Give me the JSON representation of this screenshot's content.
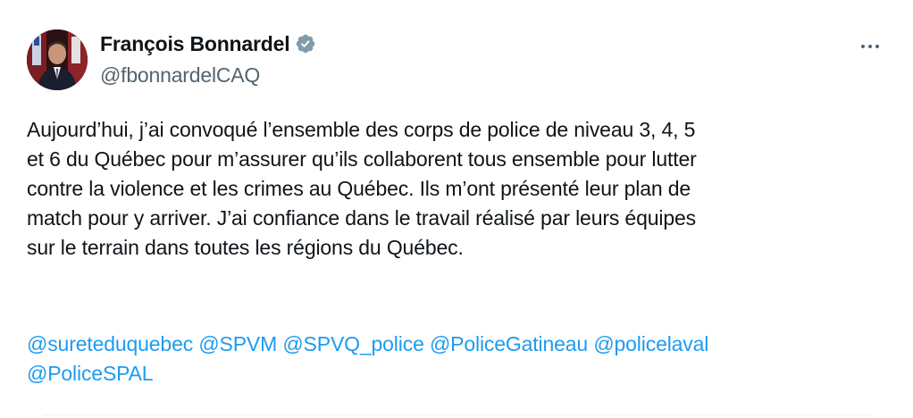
{
  "tweet": {
    "author": {
      "display_name": "François Bonnardel",
      "handle": "@fbonnardelCAQ",
      "verified_icon": "verified-badge-icon",
      "verified_color": "#829aab"
    },
    "more_icon": "more-horizontal-icon",
    "text_lines": [
      "Aujourd’hui, j’ai convoqué l’ensemble des corps de police de niveau 3, 4, 5",
      "et 6 du Québec pour m’assurer qu’ils collaborent tous ensemble pour lutter",
      "contre la violence et les crimes au Québec. Ils m’ont présenté leur plan de",
      "match pour y arriver. J’ai confiance dans le travail réalisé par leurs équipes",
      "sur le terrain dans toutes les régions du Québec."
    ],
    "mentions_row1": [
      "@sureteduquebec",
      "@SPVM",
      "@SPVQ_police",
      "@PoliceGatineau",
      "@policelaval"
    ],
    "mentions_row2": [
      "@PoliceSPAL"
    ],
    "colors": {
      "link": "#1d9bf0",
      "secondary_text": "#536471",
      "primary_text": "#0f1419"
    }
  }
}
